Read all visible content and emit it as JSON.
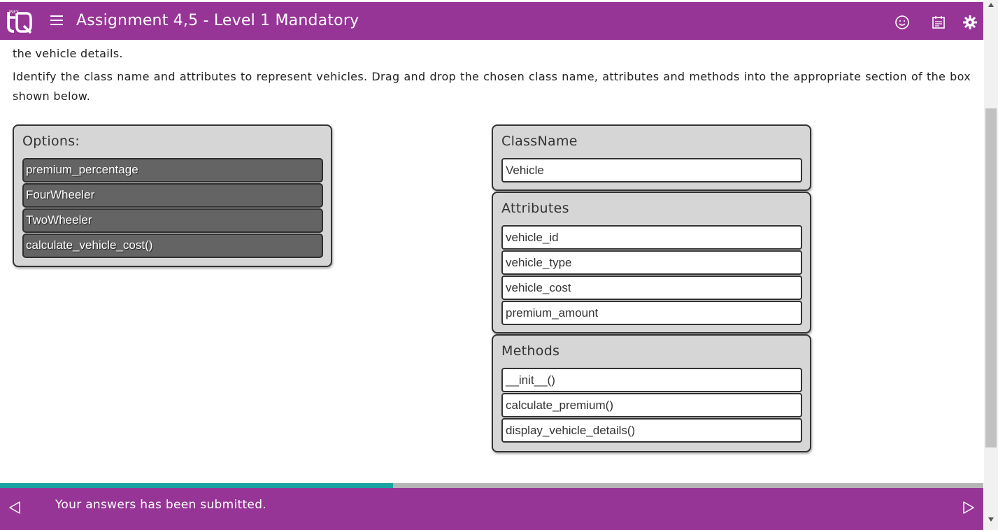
{
  "header": {
    "logo_text": "INFY TQ",
    "title": "Assignment 4,5 - Level 1 Mandatory",
    "icons": [
      "menu-icon",
      "smiley-icon",
      "calendar-icon",
      "settings-icon"
    ],
    "color": "#963596"
  },
  "content": {
    "line1": "the vehicle details.",
    "instructions": "Identify the class name and attributes to represent vehicles. Drag and drop the chosen class name, attributes and methods into the appropriate section of the box shown below."
  },
  "options": {
    "title": "Options:",
    "items": [
      "premium_percentage",
      "FourWheeler",
      "TwoWheeler",
      "calculate_vehicle_cost()"
    ]
  },
  "class_box": {
    "title": "ClassName",
    "items": [
      "Vehicle"
    ]
  },
  "attributes_box": {
    "title": "Attributes",
    "items": [
      "vehicle_id",
      "vehicle_type",
      "vehicle_cost",
      "premium_amount"
    ]
  },
  "methods_box": {
    "title": "Methods",
    "items": [
      "__init__()",
      "calculate_premium()",
      "display_vehicle_details()"
    ]
  },
  "progress": {
    "fraction": 0.4,
    "fill_color": "#1aa2a2"
  },
  "footer": {
    "message": "Your answers has been submitted.",
    "prev_icon": "triangle-left-icon",
    "next_icon": "triangle-right-icon"
  }
}
